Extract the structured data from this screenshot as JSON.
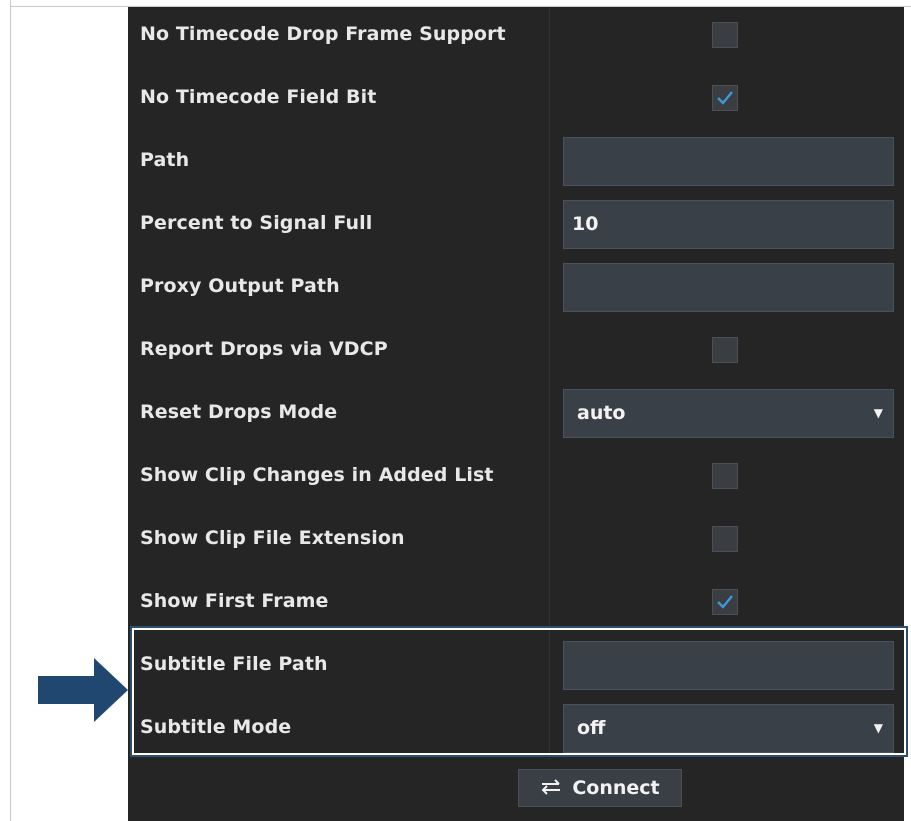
{
  "settings": [
    {
      "label": "No Timecode Drop Frame Support",
      "type": "checkbox",
      "checked": false
    },
    {
      "label": "No Timecode Field Bit",
      "type": "checkbox",
      "checked": true
    },
    {
      "label": "Path",
      "type": "text",
      "value": ""
    },
    {
      "label": "Percent to Signal Full",
      "type": "text",
      "value": "10"
    },
    {
      "label": "Proxy Output Path",
      "type": "text",
      "value": ""
    },
    {
      "label": "Report Drops via VDCP",
      "type": "checkbox",
      "checked": false
    },
    {
      "label": "Reset Drops Mode",
      "type": "select",
      "value": "auto"
    },
    {
      "label": "Show Clip Changes in Added List",
      "type": "checkbox",
      "checked": false
    },
    {
      "label": "Show Clip File Extension",
      "type": "checkbox",
      "checked": false
    },
    {
      "label": "Show First Frame",
      "type": "checkbox",
      "checked": true
    },
    {
      "label": "Subtitle File Path",
      "type": "text",
      "value": ""
    },
    {
      "label": "Subtitle Mode",
      "type": "select",
      "value": "off"
    }
  ],
  "connect_button": {
    "label": "Connect",
    "icon": "swap-arrows-icon"
  },
  "annotation": {
    "arrow_icon": "pointer-arrow-icon",
    "arrow_color": "#1f4770",
    "highlight_color": "#2b5070"
  },
  "colors": {
    "panel_bg": "#252526",
    "input_bg": "#394048",
    "check_color": "#3e9ad6"
  }
}
